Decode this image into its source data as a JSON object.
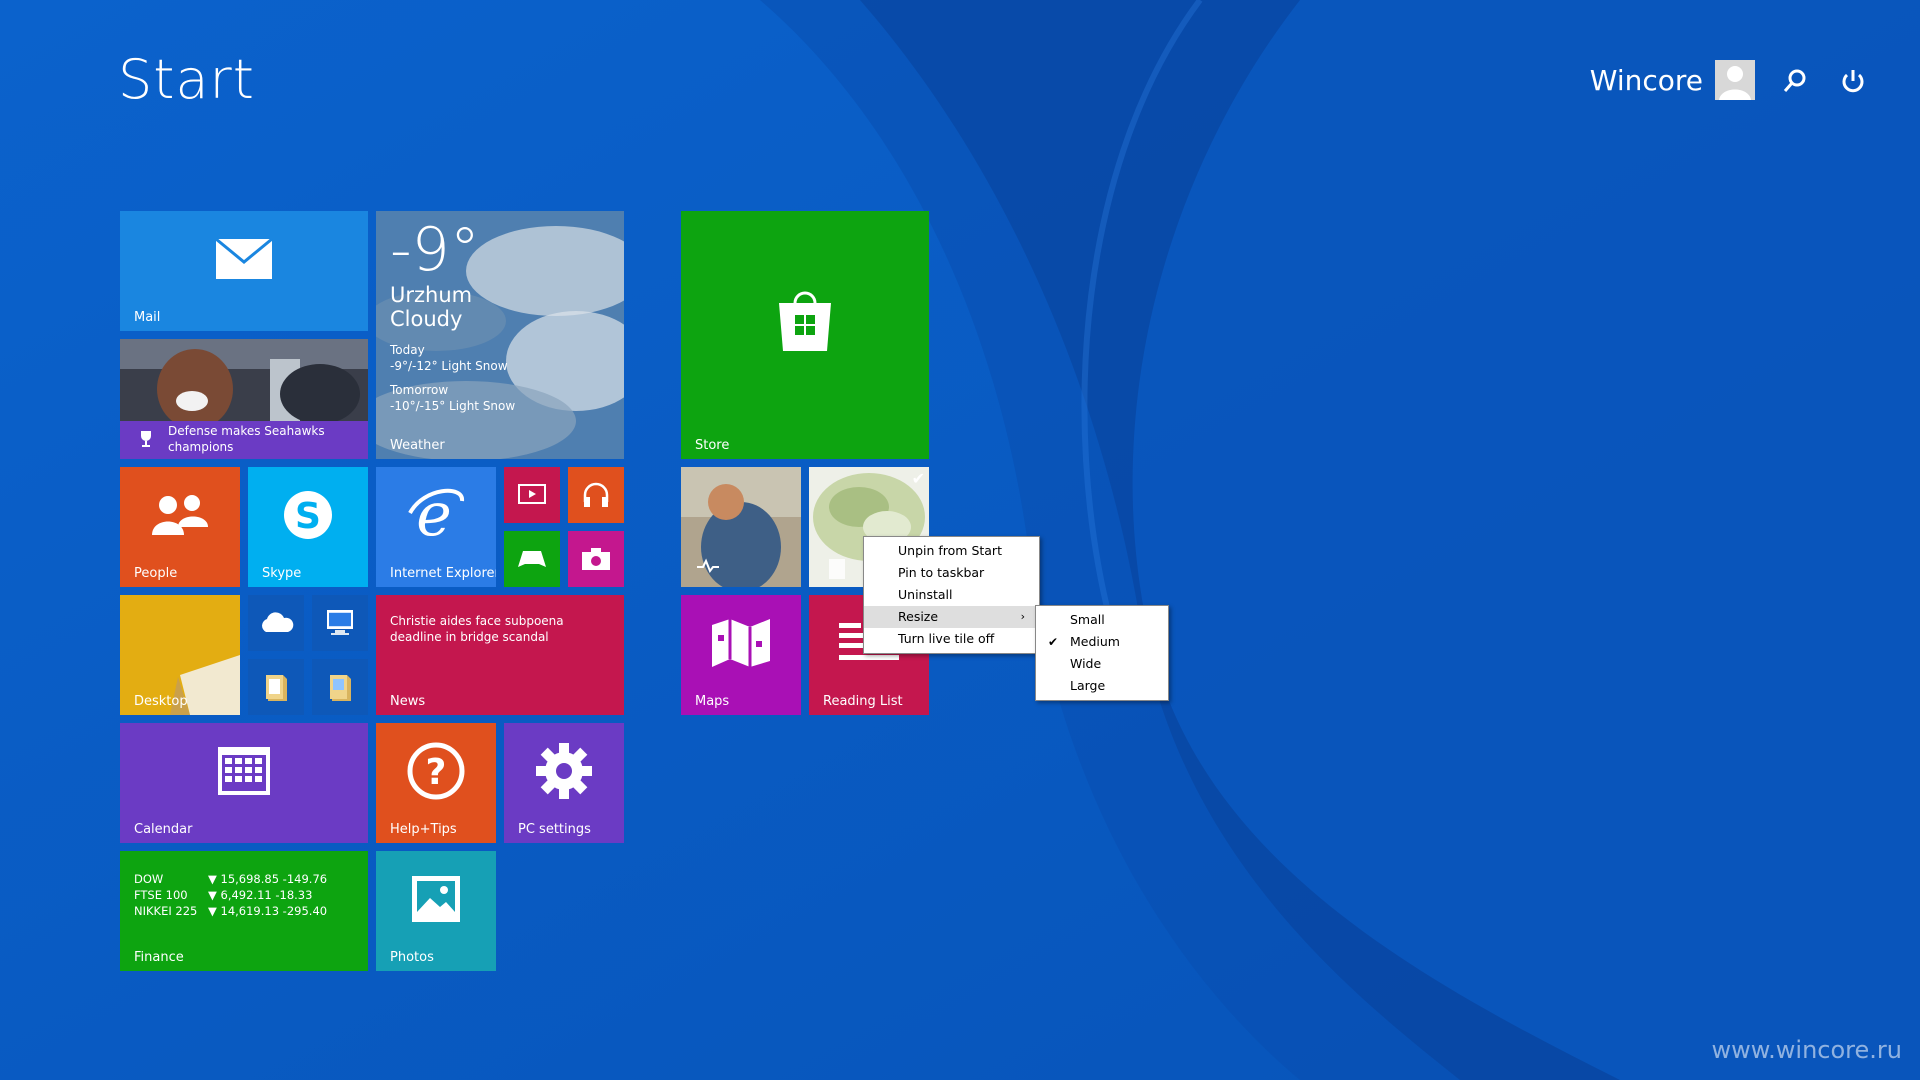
{
  "header": {
    "title": "Start",
    "user_name": "Wincore"
  },
  "tiles": {
    "mail": {
      "label": "Mail"
    },
    "people_news": {
      "headline": "Defense makes Seahawks champions"
    },
    "weather": {
      "temp": "-9°",
      "city": "Urzhum",
      "condition": "Cloudy",
      "today_label": "Today",
      "today_forecast": "-9°/-12° Light Snow",
      "tomorrow_label": "Tomorrow",
      "tomorrow_forecast": "-10°/-15° Light Snow",
      "label": "Weather"
    },
    "store": {
      "label": "Store"
    },
    "people": {
      "label": "People"
    },
    "skype": {
      "label": "Skype"
    },
    "ie": {
      "label": "Internet Explorer"
    },
    "desktop": {
      "label": "Desktop"
    },
    "news": {
      "headline": "Christie aides face subpoena deadline in bridge scandal",
      "label": "News"
    },
    "maps": {
      "label": "Maps"
    },
    "reading_list": {
      "label": "Reading List"
    },
    "calendar": {
      "label": "Calendar"
    },
    "help": {
      "label": "Help+Tips"
    },
    "pc_settings": {
      "label": "PC settings"
    },
    "finance": {
      "rows": [
        {
          "name": "DOW",
          "value": "▼ 15,698.85 -149.76"
        },
        {
          "name": "FTSE 100",
          "value": "▼ 6,492.11 -18.33"
        },
        {
          "name": "NIKKEI 225",
          "value": "▼ 14,619.13 -295.40"
        }
      ],
      "label": "Finance"
    },
    "photos": {
      "label": "Photos"
    }
  },
  "context_menu": {
    "items": [
      "Unpin from Start",
      "Pin to taskbar",
      "Uninstall",
      "Resize",
      "Turn live tile off"
    ],
    "highlighted": "Resize"
  },
  "resize_submenu": {
    "items": [
      "Small",
      "Medium",
      "Wide",
      "Large"
    ],
    "checked": "Medium"
  },
  "watermark": "www.wincore.ru",
  "colors": {
    "background": "#0a5fc8",
    "mail": "#1a86e0",
    "people": "#e0501e",
    "skype": "#00aff0",
    "ie": "#2b7ce6",
    "store": "#0da410",
    "news": "#c4174e",
    "maps": "#a910b5",
    "reading_list": "#c4174e",
    "calendar": "#6b3bc4",
    "help": "#e0501e",
    "pc_settings": "#6b3bc4",
    "finance": "#0da410",
    "photos": "#16a0b5"
  }
}
